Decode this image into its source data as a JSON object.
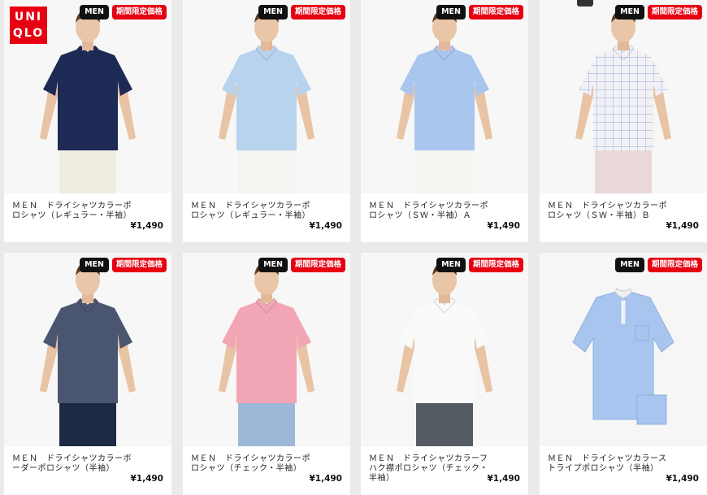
{
  "brand": {
    "logo_line1": "UNI",
    "logo_line2": "QLO"
  },
  "badges": {
    "men": "MEN",
    "sale": "期間限定価格"
  },
  "products": [
    {
      "name": "ＭＥＮ　ドライシャツカラーポロシャツ（レギュラー・半袖）",
      "price": "¥1,490",
      "shirt_color": "#1c2a55",
      "pants_color": "#f0ece2",
      "style": "plain"
    },
    {
      "name": "ＭＥＮ　ドライシャツカラーポロシャツ（レギュラー・半袖）",
      "price": "¥1,490",
      "shirt_color": "#b7d3ee",
      "pants_color": "#f4f4f0",
      "style": "plain"
    },
    {
      "name": "ＭＥＮ　ドライシャツカラーポロシャツ（ＳＷ・半袖）Ａ",
      "price": "¥1,490",
      "shirt_color": "#a9c6ef",
      "pants_color": "#f4f4f0",
      "style": "plain"
    },
    {
      "name": "ＭＥＮ　ドライシャツカラーポロシャツ（ＳＷ・半袖）Ｂ",
      "price": "¥1,490",
      "shirt_color": "#f2f2f6",
      "pants_color": "#e8d8d8",
      "style": "check"
    },
    {
      "name": "ＭＥＮ　ドライシャツカラーボーダーポロシャツ（半袖）",
      "price": "¥1,490",
      "shirt_color": "#4a5570",
      "pants_color": "#1e2a44",
      "style": "plain"
    },
    {
      "name": "ＭＥＮ　ドライシャツカラーポロシャツ（チェック・半袖）",
      "price": "¥1,490",
      "shirt_color": "#f2a5b5",
      "pants_color": "#9db8d8",
      "style": "plain"
    },
    {
      "name": "ＭＥＮ　ドライシャツカラーフハク襟ポロシャツ（チェック・半袖）",
      "price": "¥1,490",
      "shirt_color": "#fafafa",
      "pants_color": "#555b62",
      "style": "plain"
    },
    {
      "name": "ＭＥＮ　ドライシャツカラーストライプポロシャツ（半袖）",
      "price": "¥1,490",
      "shirt_color": "#a7c5ee",
      "pants_color": "",
      "style": "flat"
    }
  ]
}
